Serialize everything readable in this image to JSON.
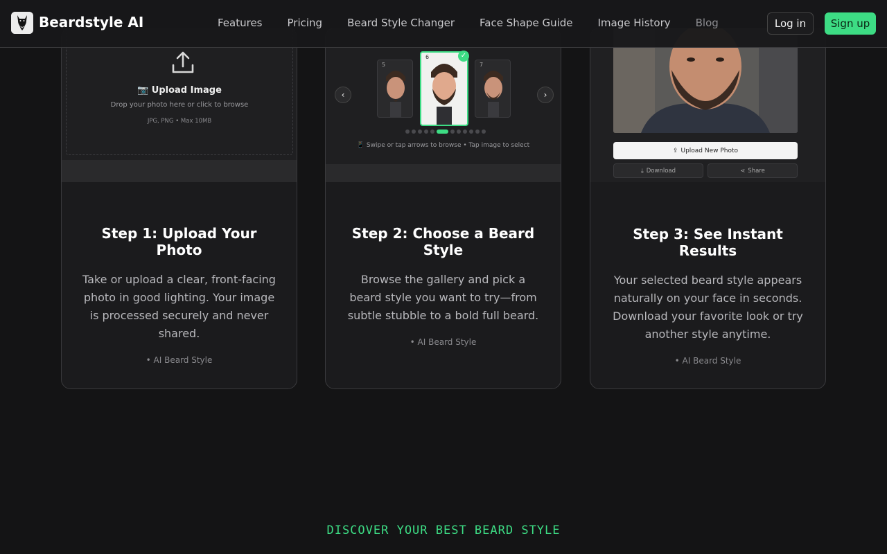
{
  "header": {
    "brand": "Beardstyle AI",
    "nav": [
      "Features",
      "Pricing",
      "Beard Style Changer",
      "Face Shape Guide",
      "Image History",
      "Blog"
    ],
    "login": "Log in",
    "signup": "Sign up"
  },
  "steps": [
    {
      "title": "Step 1: Upload Your Photo",
      "text": "Take or upload a clear, front-facing photo in good lighting. Your image is processed securely and never shared.",
      "tag": "• AI Beard Style",
      "upload_title": "📷 Upload Image",
      "upload_sub": "Drop your photo here or click to browse",
      "upload_formats": "JPG, PNG • Max 10MB"
    },
    {
      "title": "Step 2: Choose a Beard Style",
      "text": "Browse the gallery and pick a beard style you want to try—from subtle stubble to a bold full beard.",
      "tag": "• AI Beard Style",
      "thumb_numbers": [
        "5",
        "6",
        "7"
      ],
      "hint": "📱 Swipe or tap arrows to browse • Tap image to select"
    },
    {
      "title": "Step 3: See Instant Results",
      "text": "Your selected beard style appears naturally on your face in seconds. Download your favorite look or try another style anytime.",
      "tag": "• AI Beard Style",
      "upload_new": "Upload New Photo",
      "download": "Download",
      "share": "Share"
    }
  ],
  "discover": "DISCOVER YOUR BEST BEARD STYLE",
  "colors": {
    "accent": "#3ddc84",
    "background": "#141415",
    "card": "#1b1b1d"
  }
}
